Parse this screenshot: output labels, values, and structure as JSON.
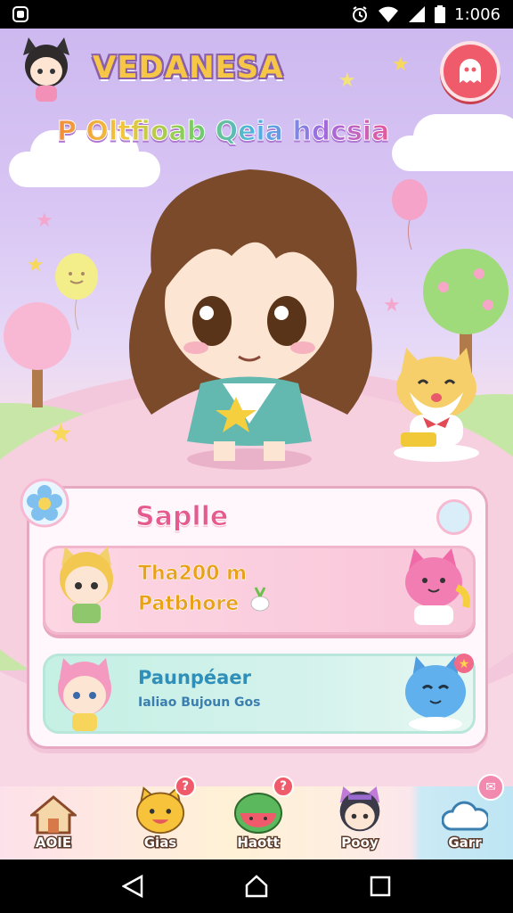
{
  "status_bar": {
    "time": "1:006",
    "icons": [
      "app-notification-icon",
      "alarm-icon",
      "wifi-icon",
      "signal-icon",
      "battery-icon"
    ]
  },
  "header": {
    "title": "VEDANESA",
    "subtitle": "P Oltfioab Qeia hdcsia"
  },
  "panel": {
    "title": "Saplle",
    "cards": [
      {
        "line1": "Tha200 m",
        "line2": "Patbhore"
      },
      {
        "line1": "Paunpéaer",
        "line2": "Ialiao Bujoun Gos"
      }
    ]
  },
  "nav": {
    "items": [
      {
        "label": "AOIE",
        "icon": "house-icon",
        "badge": ""
      },
      {
        "label": "Gias",
        "icon": "cat-face-icon",
        "badge": "?"
      },
      {
        "label": "Haott",
        "icon": "watermelon-icon",
        "badge": "?"
      },
      {
        "label": "Pooy",
        "icon": "character-icon",
        "badge": ""
      },
      {
        "label": "Garr",
        "icon": "cloud-icon",
        "badge": ""
      }
    ]
  },
  "colors": {
    "accent_pink": "#e55b8f",
    "menu_red": "#ef5b6a",
    "title_yellow": "#f6c746",
    "card_pink": "#f8c6d9",
    "card_mint": "#c5f0e4"
  }
}
